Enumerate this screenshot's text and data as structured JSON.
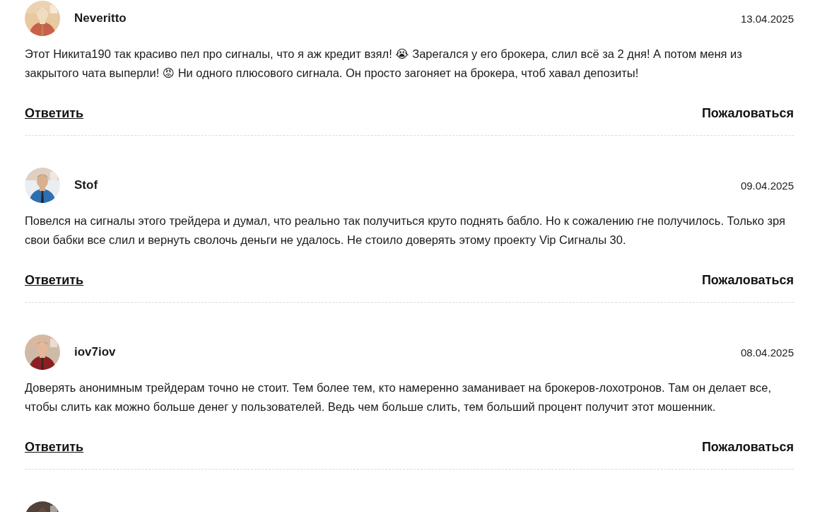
{
  "comments": [
    {
      "avatar": {
        "kind": "picture"
      },
      "author": "Neveritto",
      "date": "13.04.2025",
      "body": "Этот Никита190 так красиво пел про сигналы, что я аж кредит взял! 😭 Зарегался у его брокера, слил всё за 2 дня! А потом меня из закрытого чата выперли! 😡 Ни одного плюсового сигнала. Он просто загоняет на брокера, чтоб хавал депозиты!",
      "reply": "Ответить",
      "report": "Пожаловаться"
    },
    {
      "avatar": {
        "kind": "picture"
      },
      "author": "Stof",
      "date": "09.04.2025",
      "body": "Повелся на сигналы этого трейдера и думал, что реально так получиться круто поднять бабло. Но к сожалению гне получилось. Только зря свои бабки все слил и вернуть сволочь деньги не удалось. Не стоило доверять этому проекту Vip Сигналы 30.",
      "reply": "Ответить",
      "report": "Пожаловаться"
    },
    {
      "avatar": {
        "kind": "picture"
      },
      "author": "iov7iov",
      "date": "08.04.2025",
      "body": "Доверять анонимным трейдерам точно не стоит. Тем более тем, кто намеренно заманивает на брокеров-лохотронов. Там он делает все, чтобы слить как можно больше денег у пользователей. Ведь чем больше слить, тем больший процент получит этот мошенник.",
      "reply": "Ответить",
      "report": "Пожаловаться"
    },
    {
      "avatar": {
        "kind": "picture"
      }
    }
  ]
}
